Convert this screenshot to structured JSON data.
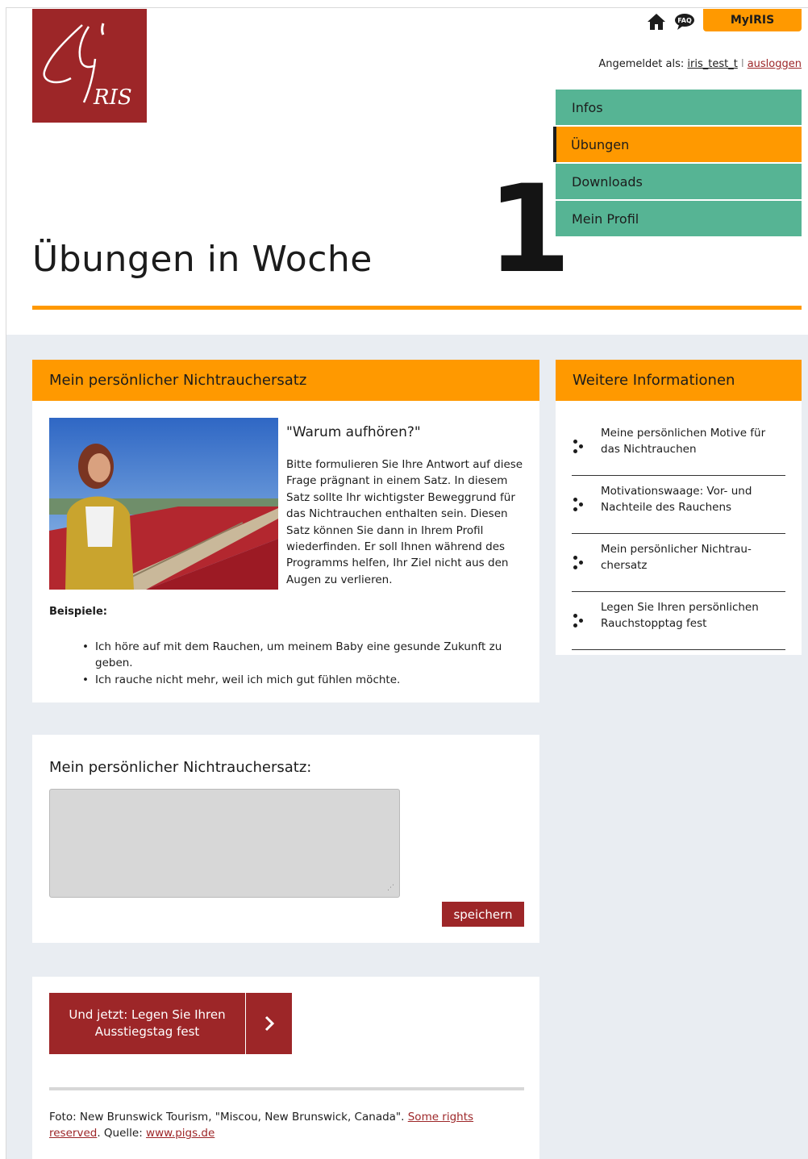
{
  "header": {
    "logo_text": "IRIS",
    "myiris_label": "MyIRIS",
    "home_icon": "home-icon",
    "faq_icon": "FAQ",
    "logged_in_label": "Angemeldet als:",
    "username": "iris_test_t",
    "separator": "l",
    "logout_label": "ausloggen",
    "title": "Übungen in Woche",
    "week_number": "1"
  },
  "nav": {
    "items": [
      {
        "label": "Infos"
      },
      {
        "label": "Übungen"
      },
      {
        "label": "Downloads"
      },
      {
        "label": "Mein Profil"
      }
    ],
    "active_index": 1
  },
  "main_card": {
    "heading": "Mein persönlicher Nichtrauchersatz",
    "question": "\"Warum aufhören?\"",
    "body": "Bitte formulieren Sie Ihre Antwort auf diese Frage prägnant in einem Satz. In diesem Satz sollte Ihr wichtigster Beweggrund für das Nichtrauchen enthalten sein. Diesen Satz können Sie dann in Ihrem Profil wiederfinden. Er soll Ihnen während des Programms helfen, Ihr Ziel nicht aus den Augen zu verlieren.",
    "examples_label": "Beispiele:",
    "examples": [
      "Ich höre auf mit dem Rauchen, um meinem Baby eine gesunde Zukunft zu geben.",
      "Ich rauche nicht mehr, weil ich mich gut fühlen möchte."
    ]
  },
  "sidebar": {
    "heading": "Weitere Informationen",
    "items": [
      {
        "label": "Meine persönlichen Motive für das Nichtrauchen"
      },
      {
        "label": "Motivationswaage: Vor- und Nachteile des Rauchens"
      },
      {
        "label": "Mein persönlicher Nichtrau­chersatz"
      },
      {
        "label": "Legen Sie Ihren persönlichen Rauchstopptag fest"
      }
    ]
  },
  "form": {
    "title": "Mein persönlicher Nichtrauchersatz:",
    "value": "",
    "save_label": "speichern"
  },
  "cta": {
    "label": "Und jetzt: Legen Sie Ihren Ausstiegstag fest"
  },
  "credits": {
    "prefix": "Foto: New Brunswick Tourism, \"Miscou, New Brunswick, Canada\". ",
    "license_link": "Some rights reserved",
    "source_label": ". Quelle: ",
    "source_link": "www.pigs.de"
  },
  "colors": {
    "orange": "#ff9900",
    "green": "#56b494",
    "red": "#9d2628",
    "background": "#e9edf2"
  }
}
